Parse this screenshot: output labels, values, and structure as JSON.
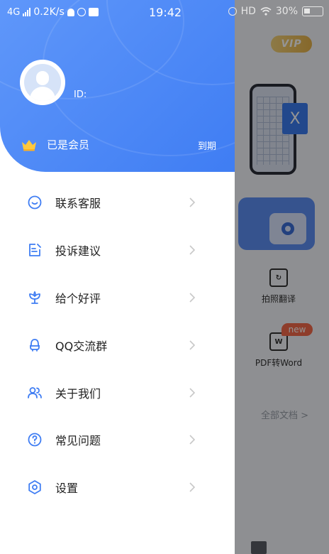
{
  "status_bar": {
    "network": "4G",
    "speed": "0.2K/s",
    "time": "19:42",
    "hd": "HD",
    "battery": "30%"
  },
  "drawer": {
    "user_id_label": "ID:",
    "member_status": "已是会员",
    "expire_label": "到期",
    "menu": [
      {
        "label": "联系客服",
        "icon": "customer-service-icon"
      },
      {
        "label": "投诉建议",
        "icon": "edit-feedback-icon"
      },
      {
        "label": "给个好评",
        "icon": "flower-rating-icon"
      },
      {
        "label": "QQ交流群",
        "icon": "qq-group-icon"
      },
      {
        "label": "关于我们",
        "icon": "people-icon"
      },
      {
        "label": "常见问题",
        "icon": "question-icon"
      },
      {
        "label": "设置",
        "icon": "settings-icon"
      }
    ]
  },
  "background": {
    "vip_badge": "VIP",
    "x_badge": "X",
    "photo_translate": "拍照翻译",
    "pdf_to_word": "PDF转Word",
    "word_badge": "W",
    "new_badge": "new",
    "all_docs": "全部文档 >"
  },
  "colors": {
    "header_blue": "#4a86f5",
    "icon_blue": "#3f7df3",
    "text_dark": "#222222",
    "chevron_gray": "#c8c8c8"
  }
}
